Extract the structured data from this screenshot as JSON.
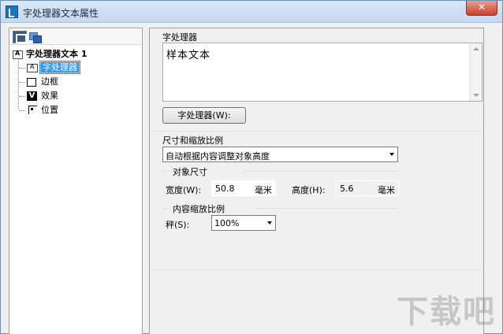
{
  "window": {
    "title": "字处理器文本属性",
    "close_label": "✕"
  },
  "tree": {
    "root": "字处理器文本 1",
    "items": [
      {
        "label": "字处理器",
        "icon": "text-icon",
        "selected": true
      },
      {
        "label": "边框",
        "icon": "border-icon",
        "selected": false
      },
      {
        "label": "效果",
        "icon": "effect-icon",
        "selected": false
      },
      {
        "label": "位置",
        "icon": "position-icon",
        "selected": false
      }
    ]
  },
  "word_processor": {
    "section_label": "字处理器",
    "text_value": "样本文本",
    "button_label": "字处理器(W):"
  },
  "size_scale": {
    "section_label": "尺寸和缩放比例",
    "mode_value": "自动根据内容调整对象高度",
    "object_size": {
      "title": "对象尺寸",
      "width_label": "宽度(W):",
      "width_value": "50.8",
      "width_unit": "毫米",
      "height_label": "高度(H):",
      "height_value": "5.6",
      "height_unit": "毫米"
    },
    "content_scale": {
      "title": "内容缩放比例",
      "scale_label": "秤(S):",
      "scale_value": "100%"
    }
  },
  "watermark": "下载吧"
}
